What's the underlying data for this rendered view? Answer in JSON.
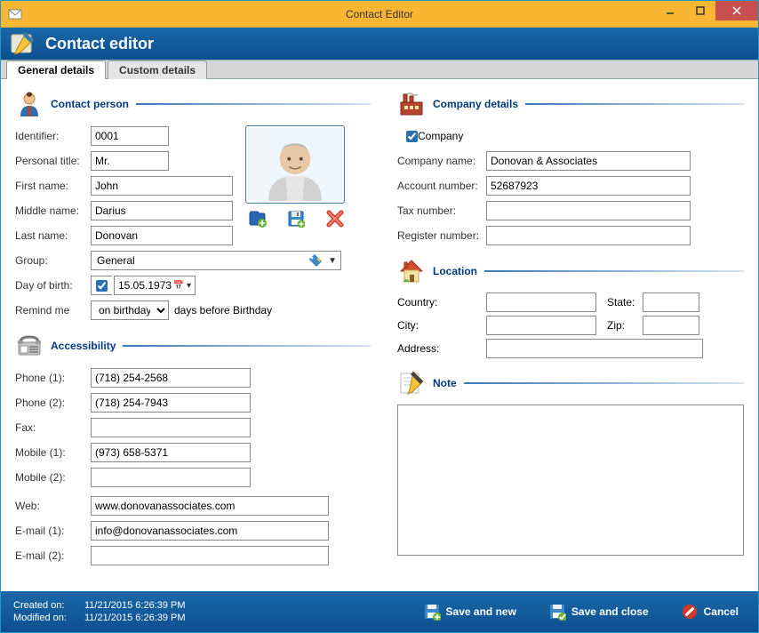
{
  "window": {
    "title": "Contact Editor"
  },
  "header": {
    "title": "Contact editor"
  },
  "tabs": {
    "general": "General details",
    "custom": "Custom details"
  },
  "person": {
    "legend": "Contact person",
    "labels": {
      "identifier": "Identifier:",
      "personal_title": "Personal title:",
      "first_name": "First name:",
      "middle_name": "Middle name:",
      "last_name": "Last name:",
      "group": "Group:",
      "dob": "Day of birth:",
      "remind": "Remind me",
      "remind_suffix": "days before Birthday"
    },
    "values": {
      "identifier": "0001",
      "personal_title": "Mr.",
      "first_name": "John",
      "middle_name": "Darius",
      "last_name": "Donovan",
      "group": "General",
      "dob": "15.05.1973",
      "remind_option": "on birthday"
    }
  },
  "accessibility": {
    "legend": "Accessibility",
    "labels": {
      "phone1": "Phone (1):",
      "phone2": "Phone (2):",
      "fax": "Fax:",
      "mobile1": "Mobile (1):",
      "mobile2": "Mobile (2):",
      "web": "Web:",
      "email1": "E-mail (1):",
      "email2": "E-mail (2):"
    },
    "values": {
      "phone1": "(718) 254-2568",
      "phone2": "(718) 254-7943",
      "fax": "",
      "mobile1": "(973) 658-5371",
      "mobile2": "",
      "web": "www.donovanassociates.com",
      "email1": "info@donovanassociates.com",
      "email2": ""
    }
  },
  "company": {
    "legend": "Company details",
    "labels": {
      "is_company": "Company",
      "name": "Company name:",
      "account": "Account number:",
      "tax": "Tax number:",
      "register": "Register number:"
    },
    "values": {
      "is_company": true,
      "name": "Donovan & Associates",
      "account": "52687923",
      "tax": "",
      "register": ""
    }
  },
  "location": {
    "legend": "Location",
    "labels": {
      "country": "Country:",
      "state": "State:",
      "city": "City:",
      "zip": "Zip:",
      "address": "Address:"
    },
    "values": {
      "country": "",
      "state": "",
      "city": "",
      "zip": "",
      "address": ""
    }
  },
  "note": {
    "legend": "Note",
    "value": ""
  },
  "footer": {
    "created_label": "Created on:",
    "created_value": "11/21/2015 6:26:39 PM",
    "modified_label": "Modified on:",
    "modified_value": "11/21/2015 6:26:39 PM",
    "save_new": "Save and new",
    "save_close": "Save and close",
    "cancel": "Cancel"
  }
}
